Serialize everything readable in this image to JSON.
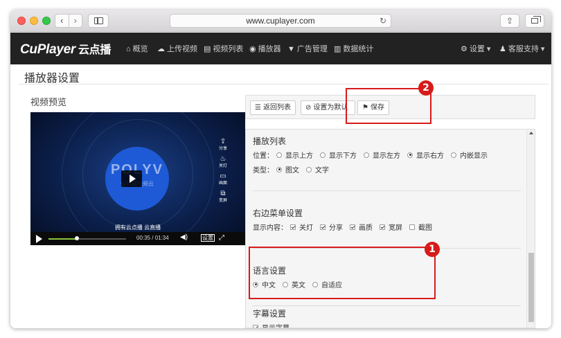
{
  "browser": {
    "url": "www.cuplayer.com",
    "reload_icon": "↻",
    "back_icon": "‹",
    "forward_icon": "›",
    "share_icon": "⇪"
  },
  "navbar": {
    "brand": "CuPlayer",
    "brand_cn": "云点播",
    "items": [
      {
        "icon": "⌂",
        "label": "概览"
      },
      {
        "icon": "☁",
        "label": "上传视频"
      },
      {
        "icon": "▤",
        "label": "视频列表"
      },
      {
        "icon": "◉",
        "label": "播放器"
      },
      {
        "icon": "▼",
        "label": "广告管理"
      },
      {
        "icon": "▥",
        "label": "数据统计"
      }
    ],
    "right": [
      {
        "icon": "⚙",
        "label": "设置 ▾"
      },
      {
        "icon": "♟",
        "label": "客服支持 ▾"
      }
    ]
  },
  "page": {
    "title": "播放器设置",
    "preview_label": "视频预览"
  },
  "video": {
    "logo_text": "POLYV",
    "logo_sub": "保利威视频云",
    "side_tools": [
      {
        "icon": "⇪",
        "label": "分享"
      },
      {
        "icon": "♨",
        "label": "关灯"
      },
      {
        "icon": "▭",
        "label": "画面"
      },
      {
        "icon": "⧉",
        "label": "变屏"
      }
    ],
    "watermark": "拥有云点播 云直播",
    "time": "00:35 / 01:34",
    "progress": 0.37,
    "vol_icon": "◀)",
    "settings_label": "设置",
    "fullscreen_icon": "⤢"
  },
  "toolbar": {
    "back_list": {
      "icon": "☰",
      "label": "返回列表"
    },
    "set_default": {
      "icon": "⊘",
      "label": "设置为默认"
    },
    "save": {
      "icon": "⚑",
      "label": "保存"
    }
  },
  "settings": {
    "playlist": {
      "title": "播放列表",
      "position_label": "位置：",
      "positions": [
        "显示上方",
        "显示下方",
        "显示左方",
        "显示右方",
        "内嵌显示"
      ],
      "position_selected": "显示右方",
      "type_label": "类型：",
      "types": [
        "图文",
        "文字"
      ],
      "type_selected": "图文"
    },
    "right_menu": {
      "title": "右边菜单设置",
      "display_label": "显示内容：",
      "items": [
        {
          "label": "关灯",
          "checked": true
        },
        {
          "label": "分享",
          "checked": true
        },
        {
          "label": "画质",
          "checked": true
        },
        {
          "label": "宽屏",
          "checked": true
        },
        {
          "label": "截图",
          "checked": false
        }
      ]
    },
    "language": {
      "title": "语言设置",
      "options": [
        "中文",
        "英文",
        "自适应"
      ],
      "selected": "中文"
    },
    "subtitle": {
      "title": "字幕设置",
      "show_label": "显示字幕",
      "show_checked": true
    }
  },
  "annotations": [
    {
      "number": "1"
    },
    {
      "number": "2"
    }
  ],
  "colors": {
    "navbar_bg": "#222222",
    "annotation_red": "#d71a1a",
    "progress_green": "#8dc63f",
    "logo_blue": "#1e5ad6"
  }
}
